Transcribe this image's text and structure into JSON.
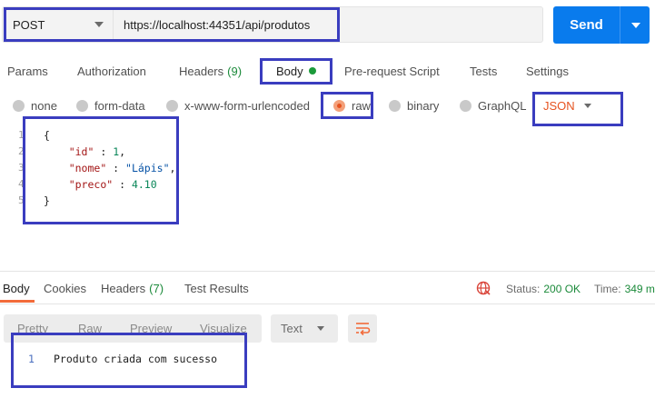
{
  "request": {
    "method": "POST",
    "url": "https://localhost:44351/api/produtos",
    "send_label": "Send"
  },
  "request_tabs": [
    {
      "label": "Params"
    },
    {
      "label": "Authorization"
    },
    {
      "label": "Headers",
      "count": "(9)"
    },
    {
      "label": "Body"
    },
    {
      "label": "Pre-request Script"
    },
    {
      "label": "Tests"
    },
    {
      "label": "Settings"
    }
  ],
  "body_types": [
    {
      "label": "none"
    },
    {
      "label": "form-data"
    },
    {
      "label": "x-www-form-urlencoded"
    },
    {
      "label": "raw"
    },
    {
      "label": "binary"
    },
    {
      "label": "GraphQL"
    }
  ],
  "body_format": "JSON",
  "editor": {
    "line_numbers": [
      "1",
      "2",
      "3",
      "4",
      "5"
    ],
    "open_brace": "{",
    "close_brace": "}",
    "fields": [
      {
        "key": "\"id\"",
        "sep": " : ",
        "value": "1",
        "comma": ","
      },
      {
        "key": "\"nome\"",
        "sep": " : ",
        "value": "\"Lápis\"",
        "comma": ","
      },
      {
        "key": "\"preco\"",
        "sep": " : ",
        "value": "4.10",
        "comma": ""
      }
    ]
  },
  "response": {
    "tabs": [
      {
        "label": "Body"
      },
      {
        "label": "Cookies"
      },
      {
        "label": "Headers",
        "count": "(7)"
      },
      {
        "label": "Test Results"
      }
    ],
    "status_label": "Status:",
    "status_value": "200 OK",
    "time_label": "Time:",
    "time_value": "349 m",
    "view_modes": [
      "Pretty",
      "Raw",
      "Preview",
      "Visualize"
    ],
    "format": "Text",
    "line_number": "1",
    "body_text": "Produto criada com sucesso"
  },
  "colors": {
    "accent": "#097bed",
    "highlight_box": "#3a3dbf",
    "status_ok": "#1b8a3a",
    "active_orange": "#e6521f"
  }
}
